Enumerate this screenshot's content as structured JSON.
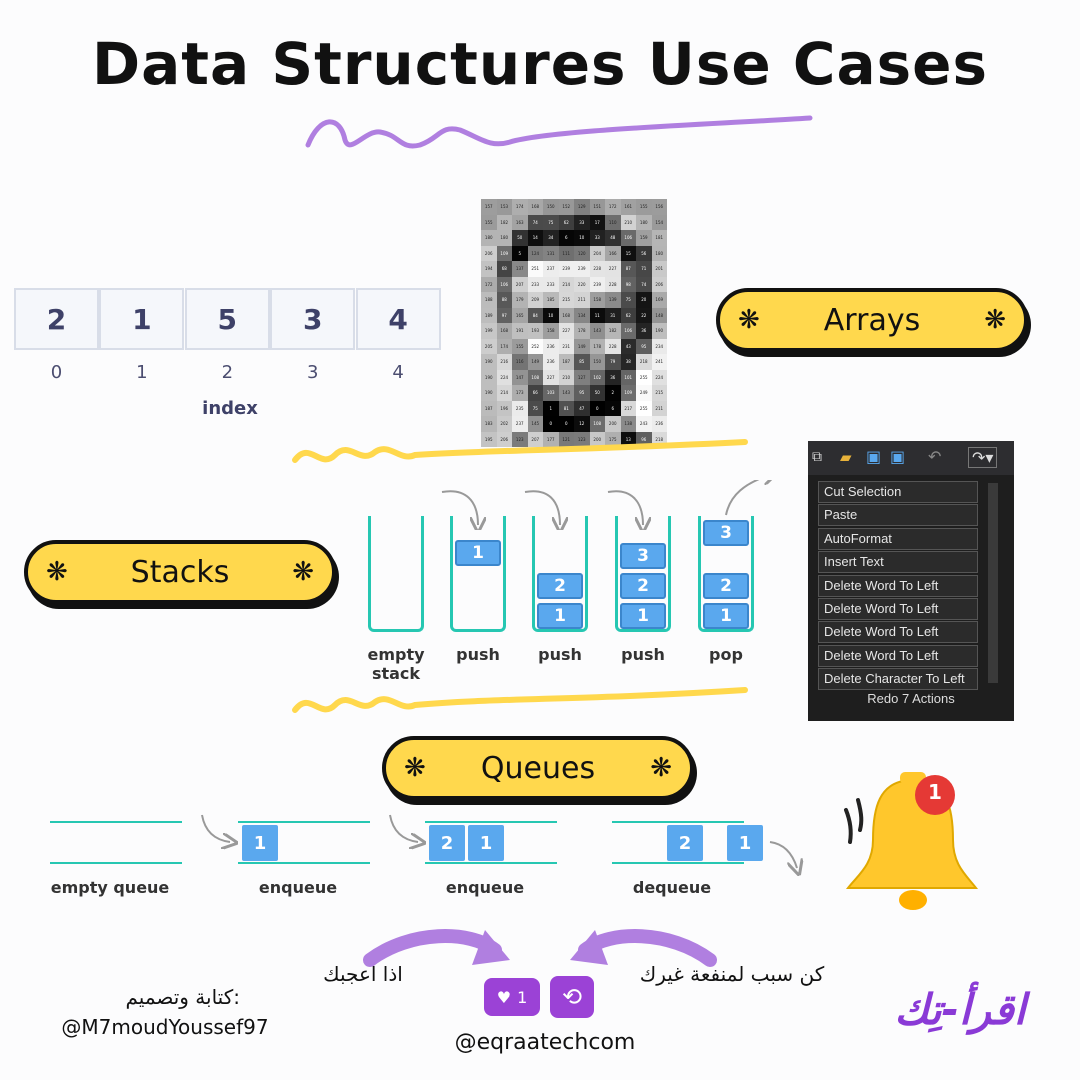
{
  "title": "Data Structures Use Cases",
  "accent": "#b07fe0",
  "pill_color": "#ffd84d",
  "arrays": {
    "label": "Arrays",
    "values": [
      "2",
      "1",
      "5",
      "3",
      "4"
    ],
    "indices": [
      "0",
      "1",
      "2",
      "3",
      "4"
    ],
    "index_caption": "index"
  },
  "stacks": {
    "label": "Stacks",
    "steps": [
      {
        "label": "empty stack",
        "blocks": []
      },
      {
        "label": "push",
        "blocks": [
          "1"
        ]
      },
      {
        "label": "push",
        "blocks": [
          "2",
          "1"
        ]
      },
      {
        "label": "push",
        "blocks": [
          "3",
          "2",
          "1"
        ]
      },
      {
        "label": "pop",
        "blocks": [
          "3",
          "2",
          "1"
        ]
      }
    ]
  },
  "queues": {
    "label": "Queues",
    "steps": [
      {
        "label": "empty queue",
        "blocks": []
      },
      {
        "label": "enqueue",
        "blocks": [
          "1"
        ]
      },
      {
        "label": "enqueue",
        "blocks": [
          "2",
          "1"
        ]
      },
      {
        "label": "dequeue",
        "blocks": [
          "2",
          "1"
        ]
      }
    ]
  },
  "menu": {
    "items": [
      "Cut Selection",
      "Paste",
      "AutoFormat",
      "Insert Text",
      "Delete Word To Left",
      "Delete Word To Left",
      "Delete Word To Left",
      "Delete Word To Left",
      "Delete Character To Left"
    ],
    "footer": "Redo 7 Actions"
  },
  "image_grid": [
    "157 153 174 168 150 152 129 151 172 161 155 156",
    "155 182 163 74 75 62 33 17 110 210 180 154",
    "180 180 50 14 34 6 10 33 48 106 159 181",
    "206 109 5 124 131 111 120 204 166 15 56 180",
    "194 68 137 251 237 239 239 228 227 87 71 201",
    "172 106 207 233 233 214 220 239 228 98 74 206",
    "188 88 179 209 185 215 211 158 139 75 20 169",
    "189 97 165 84 10 168 134 11 31 62 22 148",
    "199 168 191 193 158 227 178 143 182 106 36 190",
    "205 174 155 252 236 231 149 178 228 43 95 234",
    "190 216 116 149 236 187 85 150 79 38 218 241",
    "190 224 147 108 227 210 127 102 36 101 255 224",
    "190 214 173 66 103 143 95 50 2 109 249 215",
    "187 196 235 75 1 81 47 0 6 217 255 211",
    "183 202 237 145 0 0 12 108 200 138 243 236",
    "195 206 123 207 177 121 123 200 175 13 96 218"
  ],
  "notification_count": "1",
  "like_count": "1",
  "left_caption": "اذا اعجبك",
  "right_caption": "كن سبب لمنفعة غيرك",
  "handle": "@eqraatechcom",
  "author_label": "كتابة وتصميم:",
  "author_handle": "@M7moudYoussef97",
  "brand": "اقرأ-تِك"
}
